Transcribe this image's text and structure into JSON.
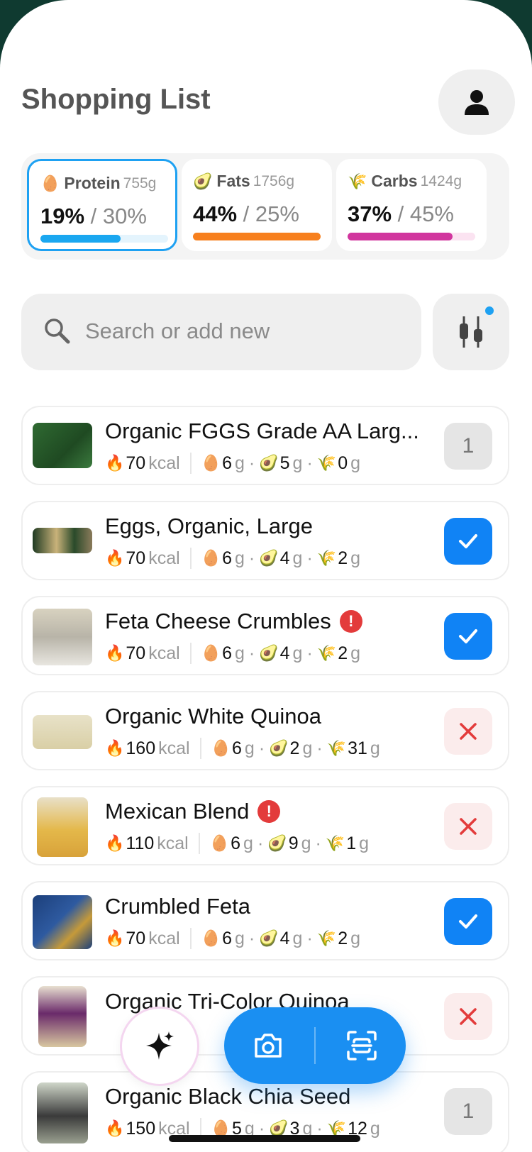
{
  "header": {
    "title": "Shopping List"
  },
  "macros": [
    {
      "name": "Protein",
      "grams": "755g",
      "current": "19%",
      "target": "30%",
      "fill": 0.63,
      "color": "#1aa7f0",
      "track": "#e4f4fd",
      "emoji": "🥚"
    },
    {
      "name": "Fats",
      "grams": "1756g",
      "current": "44%",
      "target": "25%",
      "fill": 1.0,
      "color": "#f7801e",
      "track": "#fde8d5",
      "emoji": "🥑"
    },
    {
      "name": "Carbs",
      "grams": "1424g",
      "current": "37%",
      "target": "45%",
      "fill": 0.82,
      "color": "#d1369e",
      "track": "#fbe3f1",
      "emoji": "🌾"
    }
  ],
  "search": {
    "placeholder": "Search or add new"
  },
  "items": [
    {
      "name": "Organic FGGS Grade AA Larg...",
      "kcal": "70",
      "protein": "6",
      "fat": "5",
      "carbs": "0",
      "status": "count",
      "count": "1",
      "warning": false
    },
    {
      "name": "Eggs, Organic, Large",
      "kcal": "70",
      "protein": "6",
      "fat": "4",
      "carbs": "2",
      "status": "checked",
      "warning": false
    },
    {
      "name": "Feta Cheese Crumbles",
      "kcal": "70",
      "protein": "6",
      "fat": "4",
      "carbs": "2",
      "status": "checked",
      "warning": true
    },
    {
      "name": "Organic White Quinoa",
      "kcal": "160",
      "protein": "6",
      "fat": "2",
      "carbs": "31",
      "status": "removed",
      "warning": false
    },
    {
      "name": "Mexican Blend",
      "kcal": "110",
      "protein": "6",
      "fat": "9",
      "carbs": "1",
      "status": "removed",
      "warning": true
    },
    {
      "name": "Crumbled Feta",
      "kcal": "70",
      "protein": "6",
      "fat": "4",
      "carbs": "2",
      "status": "checked",
      "warning": false
    },
    {
      "name": "Organic Tri-Color Quinoa",
      "kcal": "",
      "protein": "",
      "fat": "",
      "carbs": "",
      "status": "removed",
      "warning": false
    },
    {
      "name": "Organic Black Chia Seed",
      "kcal": "150",
      "protein": "5",
      "fat": "3",
      "carbs": "12",
      "status": "count",
      "count": "1",
      "warning": false
    }
  ],
  "units": {
    "kcal": "kcal",
    "gram": "g"
  },
  "colors": {
    "accent": "#1083f5",
    "danger": "#e33b3b"
  },
  "icons": {
    "ai": "sparkles-icon",
    "camera": "camera-icon",
    "scan": "barcode-scan-icon"
  }
}
